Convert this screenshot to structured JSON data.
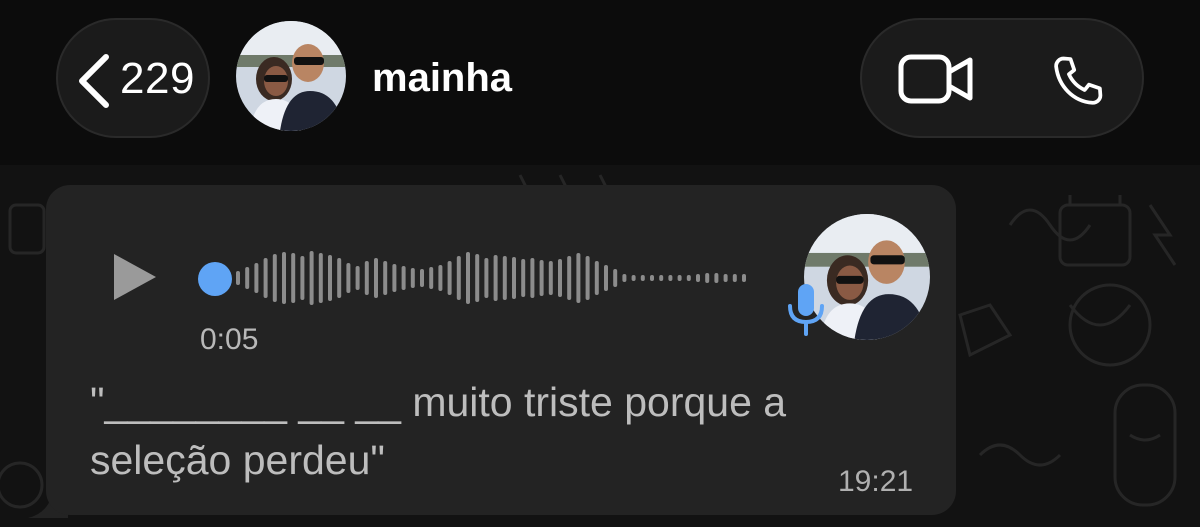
{
  "header": {
    "back_count": "229",
    "contact_name": "mainha"
  },
  "message": {
    "duration": "0:05",
    "transcript": "\"________ __ __ muito triste porque a seleção perdeu\"",
    "time": "19:21",
    "playback_progress": 0
  },
  "colors": {
    "accent_blue": "#5fa4f5",
    "bubble_bg": "#232323",
    "header_bg": "#0c0c0c"
  },
  "icons": {
    "back": "chevron-left-icon",
    "video": "video-camera-icon",
    "call": "phone-icon",
    "play": "play-icon",
    "mic": "microphone-icon"
  }
}
